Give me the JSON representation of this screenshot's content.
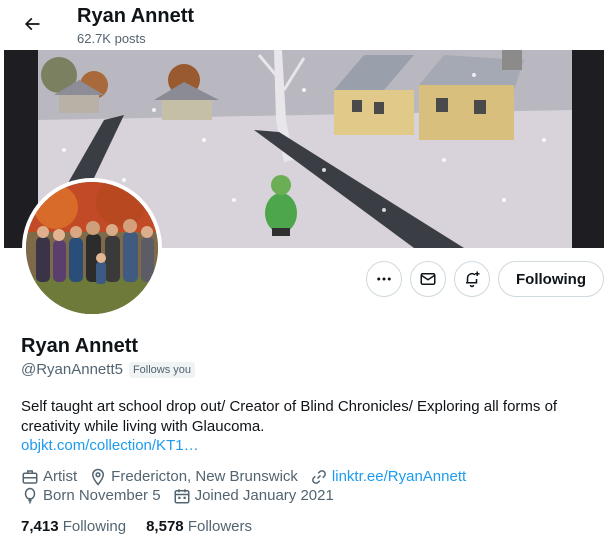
{
  "header": {
    "title": "Ryan Annett",
    "posts_count": "62.7K posts",
    "back_icon": "arrow-left-icon"
  },
  "banner": {
    "description_icon": "banner-image"
  },
  "actions": {
    "more_icon": "more-horizontal-icon",
    "message_icon": "mail-icon",
    "subscribe_icon": "notification-bell-plus-icon",
    "following_label": "Following"
  },
  "profile": {
    "name": "Ryan Annett",
    "handle": "@RyanAnnett5",
    "follows_you": "Follows you",
    "bio": "Self taught art school drop out/ Creator of Blind Chronicles/ Exploring all forms of creativity while living with Glaucoma.",
    "bio_link": "objkt.com/collection/KT1…",
    "profession": "Artist",
    "location": "Fredericton, New Brunswick",
    "website": "linktr.ee/RyanAnnett",
    "birthday": "Born November 5",
    "joined": "Joined January 2021"
  },
  "stats": {
    "following_count": "7,413",
    "following_label": "Following",
    "followers_count": "8,578",
    "followers_label": "Followers"
  },
  "colors": {
    "accent": "#1d9bf0",
    "secondary_text": "#536471",
    "border": "#cfd9de"
  }
}
